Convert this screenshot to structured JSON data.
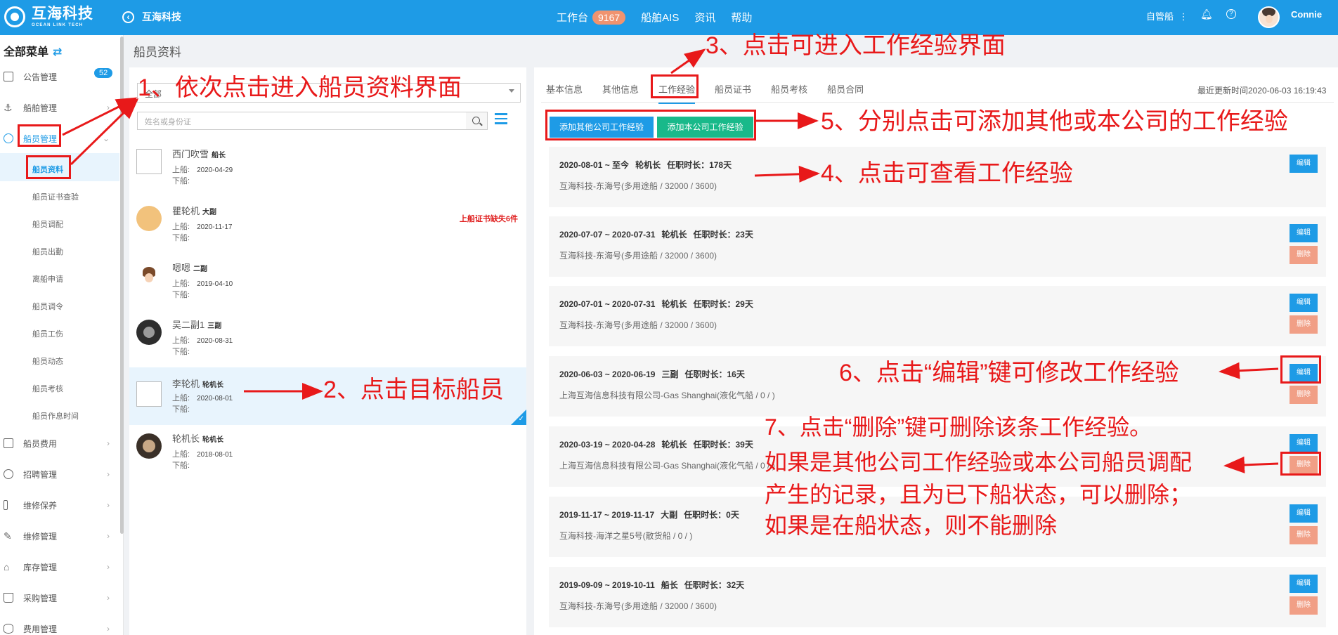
{
  "header": {
    "brand_cn": "互海科技",
    "brand_en": "OCEAN LINK TECH",
    "back_label": "互海科技",
    "nav": [
      {
        "label": "工作台",
        "badge": "9167"
      },
      {
        "label": "船舶AIS"
      },
      {
        "label": "资讯"
      },
      {
        "label": "帮助"
      }
    ],
    "owner_ship": "自管船",
    "user": "Connie"
  },
  "sidebar": {
    "title": "全部菜单",
    "items": [
      {
        "label": "公告管理",
        "count": "52"
      },
      {
        "label": "船舶管理"
      },
      {
        "label": "船员管理"
      },
      {
        "label": "船员费用"
      },
      {
        "label": "招聘管理"
      },
      {
        "label": "维修保养"
      },
      {
        "label": "维修管理"
      },
      {
        "label": "库存管理"
      },
      {
        "label": "采购管理"
      },
      {
        "label": "费用管理"
      }
    ],
    "sub_items": [
      "船员资料",
      "船员证书查验",
      "船员调配",
      "船员出勤",
      "离船申请",
      "船员调令",
      "船员工伤",
      "船员动态",
      "船员考核",
      "船员作息时间"
    ]
  },
  "page": {
    "title": "船员资料",
    "filter_value": "全部",
    "search_placeholder": "姓名或身份证"
  },
  "crew": [
    {
      "name": "西门吹雪",
      "rank": "船长",
      "board_label": "上船:",
      "board": "2020-04-29",
      "leave_label": "下船:",
      "leave": "",
      "warn": ""
    },
    {
      "name": "瞿轮机",
      "rank": "大副",
      "board_label": "上船:",
      "board": "2020-11-17",
      "leave_label": "下船:",
      "leave": "",
      "warn": "上船证书缺失6件"
    },
    {
      "name": "嗯嗯",
      "rank": "二副",
      "board_label": "上船:",
      "board": "2019-04-10",
      "leave_label": "下船:",
      "leave": "",
      "warn": ""
    },
    {
      "name": "吴二副1",
      "rank": "三副",
      "board_label": "上船:",
      "board": "2020-08-31",
      "leave_label": "下船:",
      "leave": "",
      "warn": ""
    },
    {
      "name": "李轮机",
      "rank": "轮机长",
      "board_label": "上船:",
      "board": "2020-08-01",
      "leave_label": "下船:",
      "leave": "",
      "warn": ""
    },
    {
      "name": "轮机长",
      "rank": "轮机长",
      "board_label": "上船:",
      "board": "2018-08-01",
      "leave_label": "下船:",
      "leave": "",
      "warn": ""
    }
  ],
  "tabs": [
    "基本信息",
    "其他信息",
    "工作经验",
    "船员证书",
    "船员考核",
    "船员合同"
  ],
  "updated": "最近更新时间2020-06-03 16:19:43",
  "buttons": {
    "add_other": "添加其他公司工作经验",
    "add_own": "添加本公司工作经验",
    "edit": "编辑",
    "delete": "删除"
  },
  "experience": [
    {
      "period": "2020-08-01 ~ 至今",
      "rank": "轮机长",
      "duration": "任职时长：178天",
      "detail": "互海科技-东海号(多用途船 / 32000 / 3600)",
      "deletable": false
    },
    {
      "period": "2020-07-07 ~ 2020-07-31",
      "rank": "轮机长",
      "duration": "任职时长：23天",
      "detail": "互海科技-东海号(多用途船 / 32000 / 3600)",
      "deletable": true
    },
    {
      "period": "2020-07-01 ~ 2020-07-31",
      "rank": "轮机长",
      "duration": "任职时长：29天",
      "detail": "互海科技-东海号(多用途船 / 32000 / 3600)",
      "deletable": true
    },
    {
      "period": "2020-06-03 ~ 2020-06-19",
      "rank": "三副",
      "duration": "任职时长：16天",
      "detail": "上海互海信息科技有限公司-Gas Shanghai(液化气船 / 0 / )",
      "deletable": true
    },
    {
      "period": "2020-03-19 ~ 2020-04-28",
      "rank": "轮机长",
      "duration": "任职时长：39天",
      "detail": "上海互海信息科技有限公司-Gas Shanghai(液化气船 / 0 / )",
      "deletable": true
    },
    {
      "period": "2019-11-17 ~ 2019-11-17",
      "rank": "大副",
      "duration": "任职时长：0天",
      "detail": "互海科技-海洋之星5号(散货船 / 0 / )",
      "deletable": true
    },
    {
      "period": "2019-09-09 ~ 2019-10-11",
      "rank": "船长",
      "duration": "任职时长：32天",
      "detail": "互海科技-东海号(多用途船 / 32000 / 3600)",
      "deletable": true
    }
  ],
  "annotations": {
    "a1": "1、依次点击进入船员资料界面",
    "a2": "2、点击目标船员",
    "a3": "3、点击可进入工作经验界面",
    "a4": "4、点击可查看工作经验",
    "a5": "5、分别点击可添加其他或本公司的工作经验",
    "a6": "6、点击“编辑”键可修改工作经验",
    "a7_1": "7、点击“删除”键可删除该条工作经验。",
    "a7_2": "如果是其他公司工作经验或本公司船员调配",
    "a7_3": "产生的记录，且为已下船状态，可以删除；",
    "a7_4": "如果是在船状态，则不能删除"
  },
  "colors": {
    "primary": "#1e9be6",
    "success": "#19b98a",
    "danger_light": "#f19f86",
    "annotation": "#e8191a"
  }
}
